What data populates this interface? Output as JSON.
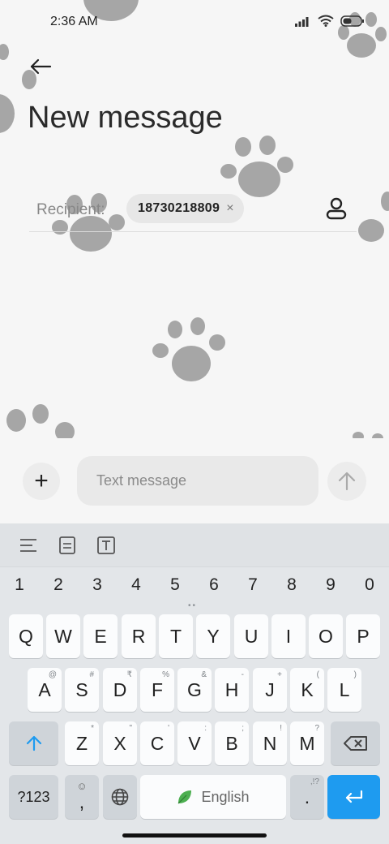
{
  "status_bar": {
    "time": "2:36 AM",
    "icons": [
      "signal-icon",
      "wifi-icon",
      "battery-icon"
    ]
  },
  "header": {
    "back_icon": "arrow-left-icon",
    "title": "New message"
  },
  "recipient": {
    "label": "Recipient:",
    "chip_value": "18730218809",
    "chip_close": "×",
    "contact_icon": "person-icon"
  },
  "compose": {
    "add_label": "+",
    "placeholder": "Text message",
    "send_icon": "arrow-up-icon"
  },
  "keyboard": {
    "toolbar": [
      "align-left-icon",
      "document-icon",
      "text-box-icon"
    ],
    "numbers": [
      "1",
      "2",
      "3",
      "4",
      "5",
      "6",
      "7",
      "8",
      "9",
      "0"
    ],
    "row1": [
      {
        "main": "Q",
        "sup": ""
      },
      {
        "main": "W",
        "sup": ""
      },
      {
        "main": "E",
        "sup": ""
      },
      {
        "main": "R",
        "sup": ""
      },
      {
        "main": "T",
        "sup": ""
      },
      {
        "main": "Y",
        "sup": ""
      },
      {
        "main": "U",
        "sup": ""
      },
      {
        "main": "I",
        "sup": ""
      },
      {
        "main": "O",
        "sup": ""
      },
      {
        "main": "P",
        "sup": ""
      }
    ],
    "row2": [
      {
        "main": "A",
        "sup": "@"
      },
      {
        "main": "S",
        "sup": "#"
      },
      {
        "main": "D",
        "sup": "₹"
      },
      {
        "main": "F",
        "sup": "%"
      },
      {
        "main": "G",
        "sup": "&"
      },
      {
        "main": "H",
        "sup": "-"
      },
      {
        "main": "J",
        "sup": "+"
      },
      {
        "main": "K",
        "sup": "("
      },
      {
        "main": "L",
        "sup": ")"
      }
    ],
    "row3": [
      {
        "main": "Z",
        "sup": "*"
      },
      {
        "main": "X",
        "sup": "\""
      },
      {
        "main": "C",
        "sup": "'"
      },
      {
        "main": "V",
        "sup": ":"
      },
      {
        "main": "B",
        "sup": ";"
      },
      {
        "main": "N",
        "sup": "!"
      },
      {
        "main": "M",
        "sup": "?"
      }
    ],
    "symbols_label": "?123",
    "emoji_comma": ",",
    "space_label": "English",
    "period": ".",
    "period_sup": ",!?",
    "accent_color": "#1e9bf0",
    "leaf_color": "#4caf50"
  }
}
